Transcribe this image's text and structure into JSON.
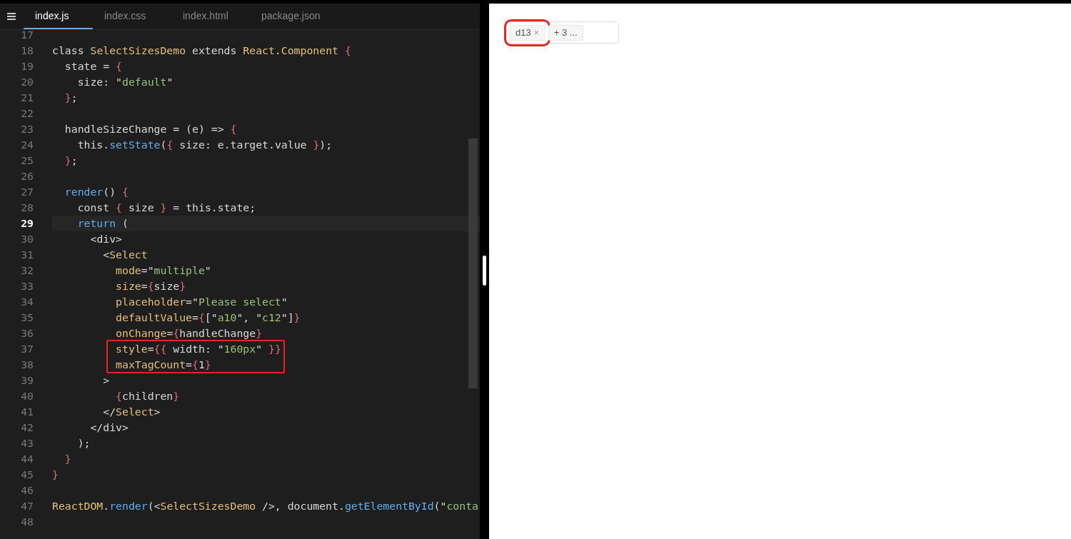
{
  "tabs": [
    {
      "label": "index.js",
      "selected": true
    },
    {
      "label": "index.css",
      "selected": false
    },
    {
      "label": "index.html",
      "selected": false
    },
    {
      "label": "package.json",
      "selected": false
    }
  ],
  "editor": {
    "lines": [
      {
        "number": "17",
        "current": false,
        "boxed": false
      },
      {
        "number": "18",
        "current": false,
        "boxed": false,
        "text": "class SelectSizesDemo extends React.Component {"
      },
      {
        "number": "19",
        "current": false,
        "boxed": false,
        "text": "  state = {"
      },
      {
        "number": "20",
        "current": false,
        "boxed": false,
        "text": "    size: \"default\""
      },
      {
        "number": "21",
        "current": false,
        "boxed": false,
        "text": "  };"
      },
      {
        "number": "22",
        "current": false,
        "boxed": false
      },
      {
        "number": "23",
        "current": false,
        "boxed": false,
        "text": "  handleSizeChange = (e) => {"
      },
      {
        "number": "24",
        "current": false,
        "boxed": false,
        "text": "    this.setState({ size: e.target.value });"
      },
      {
        "number": "25",
        "current": false,
        "boxed": false,
        "text": "  };"
      },
      {
        "number": "26",
        "current": false,
        "boxed": false
      },
      {
        "number": "27",
        "current": false,
        "boxed": false,
        "text": "  render() {"
      },
      {
        "number": "28",
        "current": false,
        "boxed": false,
        "text": "    const { size } = this.state;"
      },
      {
        "number": "29",
        "current": true,
        "boxed": false,
        "text": "    return ("
      },
      {
        "number": "30",
        "current": false,
        "boxed": false,
        "text": "      <div>"
      },
      {
        "number": "31",
        "current": false,
        "boxed": false,
        "text": "        <Select"
      },
      {
        "number": "32",
        "current": false,
        "boxed": false,
        "text": "          mode=\"multiple\""
      },
      {
        "number": "33",
        "current": false,
        "boxed": false,
        "text": "          size={size}"
      },
      {
        "number": "34",
        "current": false,
        "boxed": false,
        "text": "          placeholder=\"Please select\""
      },
      {
        "number": "35",
        "current": false,
        "boxed": false,
        "text": "          defaultValue={[\"a10\", \"c12\"]}"
      },
      {
        "number": "36",
        "current": false,
        "boxed": false,
        "text": "          onChange={handleChange}"
      },
      {
        "number": "37",
        "current": false,
        "boxed": true,
        "text": "          style={{ width: \"160px\" }}"
      },
      {
        "number": "38",
        "current": false,
        "boxed": true,
        "text": "          maxTagCount={1}"
      },
      {
        "number": "39",
        "current": false,
        "boxed": false,
        "text": "        >"
      },
      {
        "number": "40",
        "current": false,
        "boxed": false,
        "text": "          {children}"
      },
      {
        "number": "41",
        "current": false,
        "boxed": false,
        "text": "        </Select>"
      },
      {
        "number": "42",
        "current": false,
        "boxed": false,
        "text": "      </div>"
      },
      {
        "number": "43",
        "current": false,
        "boxed": false,
        "text": "    );"
      },
      {
        "number": "44",
        "current": false,
        "boxed": false,
        "text": "  }"
      },
      {
        "number": "45",
        "current": false,
        "boxed": false,
        "text": "}"
      },
      {
        "number": "46",
        "current": false,
        "boxed": false
      },
      {
        "number": "47",
        "current": false,
        "boxed": false,
        "text": "ReactDOM.render(<SelectSizesDemo />, document.getElementById(\"conta"
      },
      {
        "number": "48",
        "current": false,
        "boxed": false
      }
    ]
  },
  "preview": {
    "select": {
      "tags": [
        {
          "label": "d13",
          "close": "×",
          "boxed": true
        },
        {
          "label": "+ 3 ...",
          "boxed": false
        }
      ]
    }
  }
}
